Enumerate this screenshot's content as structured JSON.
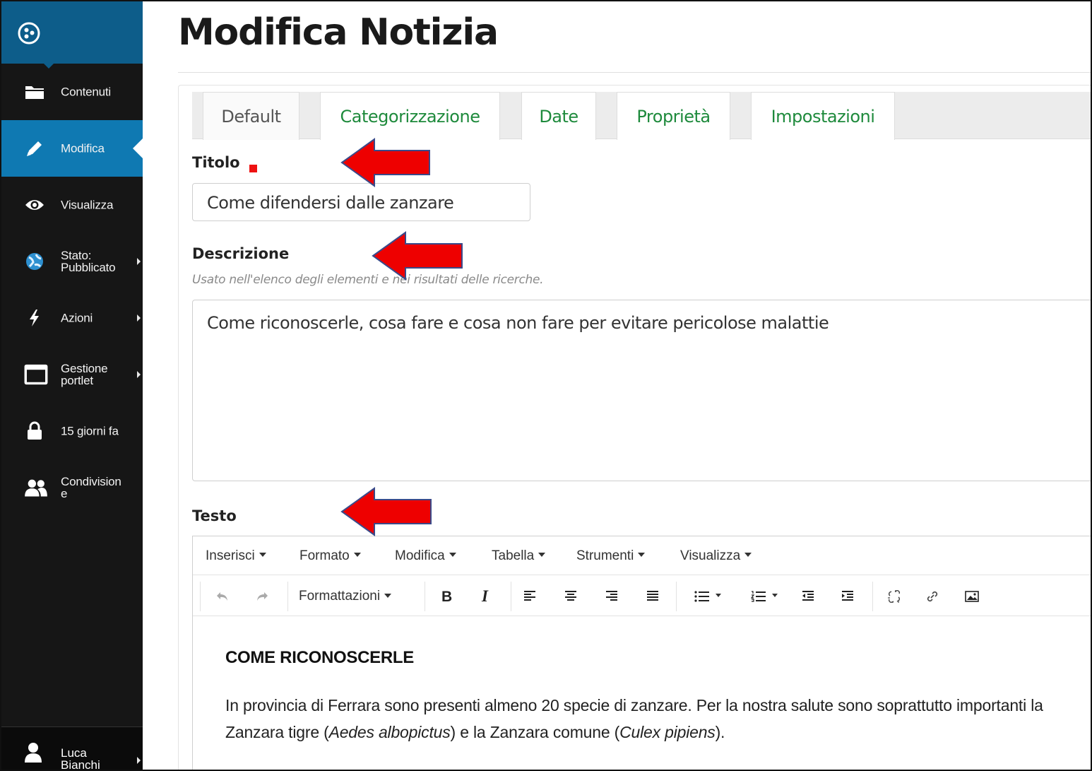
{
  "page": {
    "title": "Modifica Notizia"
  },
  "sidebar": {
    "items": [
      {
        "label": "Contenuti",
        "icon": "folder-icon"
      },
      {
        "label": "Modifica",
        "icon": "pencil-icon",
        "active": true
      },
      {
        "label": "Visualizza",
        "icon": "eye-icon"
      },
      {
        "label": "Stato:\nPubblicato",
        "icon": "globe-icon"
      },
      {
        "label": "Azioni",
        "icon": "bolt-icon"
      },
      {
        "label": "Gestione\nportlet",
        "icon": "window-icon"
      },
      {
        "label": "15 giorni fa",
        "icon": "lock-icon"
      },
      {
        "label": "Condivision\ne",
        "icon": "users-icon"
      }
    ],
    "user": {
      "label": "Luca\nBianchi",
      "icon": "user-icon"
    },
    "accent": "#0f79b2",
    "logo_bg": "#0d5d8a",
    "background": "#161616"
  },
  "tabs": [
    {
      "label": "Default",
      "active": true
    },
    {
      "label": "Categorizzazione"
    },
    {
      "label": "Date"
    },
    {
      "label": "Proprietà"
    },
    {
      "label": "Impostazioni"
    }
  ],
  "form": {
    "title_label": "Titolo",
    "title_value": "Come difendersi dalle zanzare",
    "description_label": "Descrizione",
    "description_help": "Usato nell'elenco degli elementi e nei risultati delle ricerche.",
    "description_value": "Come riconoscerle, cosa fare e cosa non fare per evitare pericolose malattie",
    "text_label": "Testo",
    "required_color": "#ee1111"
  },
  "editor": {
    "menu": [
      "Inserisci",
      "Formato",
      "Modifica",
      "Tabella",
      "Strumenti",
      "Visualizza"
    ],
    "formats_label": "Formattazioni",
    "heading": "COME RICONOSCERLE",
    "paragraph": {
      "p1": "In provincia di Ferrara sono presenti almeno 20 specie di zanzare. Per la nostra salute sono soprattutto importanti la Zanzara tigre (",
      "species1": "Aedes albopictus",
      "p2": ") e la Zanzara comune (",
      "species2": "Culex pipiens",
      "p3": ")."
    }
  },
  "annotations": {
    "arrow_color": "#ee0000",
    "arrow_stroke": "#3a4a8a"
  },
  "link_color": "#1e8a3c"
}
